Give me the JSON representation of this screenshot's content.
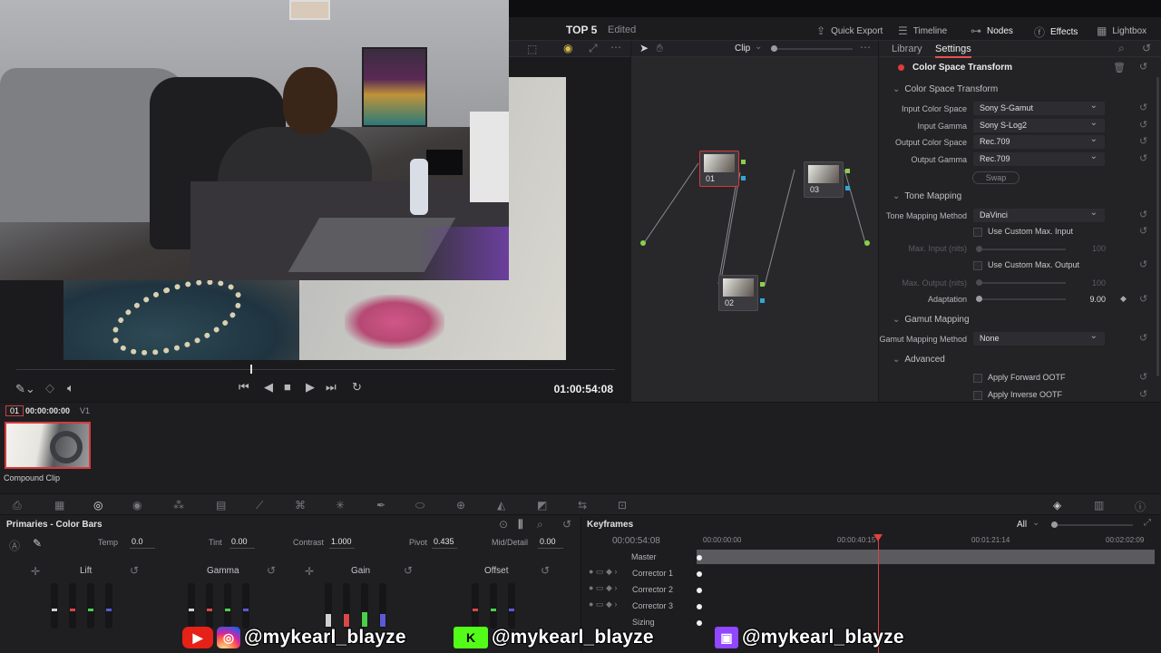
{
  "header": {
    "project_title": "TOP 5",
    "status": "Edited",
    "buttons": [
      {
        "label": "Quick Export",
        "icon": "export-icon"
      },
      {
        "label": "Timeline",
        "icon": "timeline-icon"
      },
      {
        "label": "Nodes",
        "icon": "nodes-icon"
      },
      {
        "label": "Effects",
        "icon": "fx-icon"
      },
      {
        "label": "Lightbox",
        "icon": "lightbox-icon"
      }
    ]
  },
  "nodes_bar": {
    "mode": "Clip"
  },
  "viewer": {
    "timecode": "01:00:54:08"
  },
  "node_graph": {
    "nodes": [
      "01",
      "02",
      "03"
    ]
  },
  "inspector": {
    "tabs": [
      "Library",
      "Settings"
    ],
    "effect_name": "Color Space Transform",
    "sections": {
      "cst": "Color Space Transform",
      "tone": "Tone Mapping",
      "gamut": "Gamut Mapping",
      "advanced": "Advanced"
    },
    "fields": {
      "input_color_space": {
        "label": "Input Color Space",
        "value": "Sony S-Gamut"
      },
      "input_gamma": {
        "label": "Input Gamma",
        "value": "Sony S-Log2"
      },
      "output_color_space": {
        "label": "Output Color Space",
        "value": "Rec.709"
      },
      "output_gamma": {
        "label": "Output Gamma",
        "value": "Rec.709"
      },
      "swap": "Swap",
      "tone_method": {
        "label": "Tone Mapping Method",
        "value": "DaVinci"
      },
      "custom_max_input": "Use Custom Max. Input",
      "max_input": {
        "label": "Max. Input (nits)",
        "value": "100"
      },
      "custom_max_output": "Use Custom Max. Output",
      "max_output": {
        "label": "Max. Output (nits)",
        "value": "100"
      },
      "adaptation": {
        "label": "Adaptation",
        "value": "9.00"
      },
      "gamut_method": {
        "label": "Gamut Mapping Method",
        "value": "None"
      },
      "apply_forward_ootf": "Apply Forward OOTF",
      "apply_inverse_ootf": "Apply Inverse OOTF"
    }
  },
  "clip": {
    "index": "01",
    "timecode": "00:00:00:00",
    "track": "V1",
    "name": "Compound Clip"
  },
  "primaries": {
    "title": "Primaries - Color Bars",
    "params": {
      "temp": {
        "label": "Temp",
        "value": "0.0"
      },
      "tint": {
        "label": "Tint",
        "value": "0.00"
      },
      "contrast": {
        "label": "Contrast",
        "value": "1.000"
      },
      "pivot": {
        "label": "Pivot",
        "value": "0.435"
      },
      "mid_detail": {
        "label": "Mid/Detail",
        "value": "0.00"
      }
    },
    "wheels": [
      "Lift",
      "Gamma",
      "Gain",
      "Offset"
    ]
  },
  "keyframes": {
    "title": "Keyframes",
    "filter": "All",
    "timecode": "00:00:54:08",
    "ruler": [
      "00:00:00:00",
      "00:00:40:15",
      "00:01:21:14",
      "00:02:02:09"
    ],
    "rows": [
      "Master",
      "Corrector 1",
      "Corrector 2",
      "Corrector 3",
      "Sizing"
    ]
  },
  "overlay": {
    "youtube_instagram_handle": "@mykearl_blayze",
    "kick_handle": "@mykearl_blayze",
    "twitch_handle": "@mykearl_blayze"
  }
}
